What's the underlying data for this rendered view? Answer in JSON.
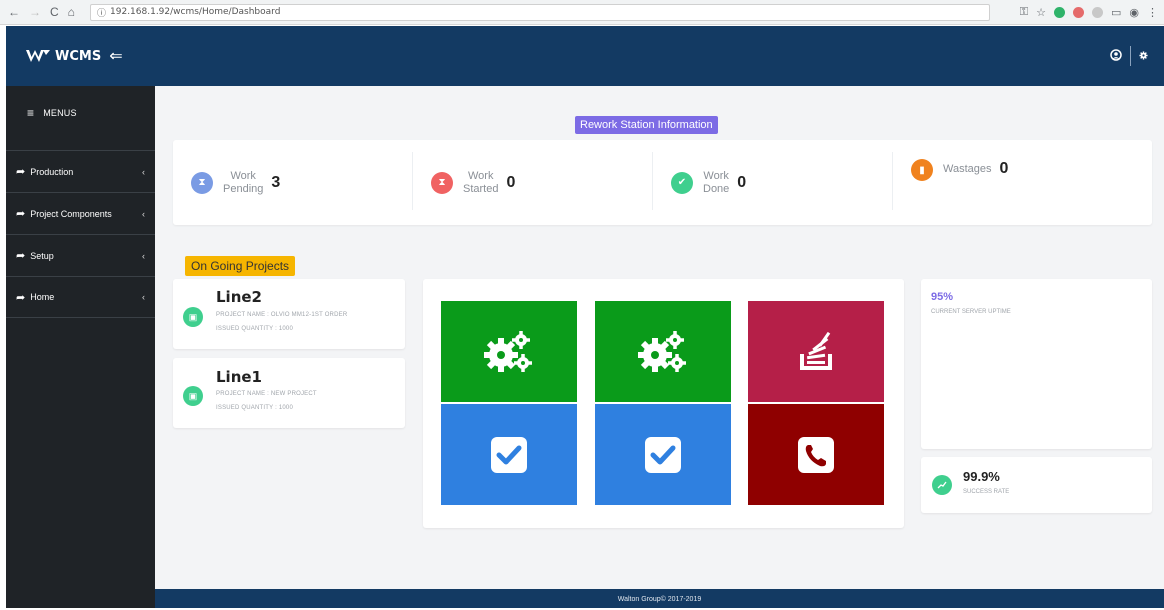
{
  "browser": {
    "url": "192.168.1.92/wcms/Home/Dashboard"
  },
  "header": {
    "app_name": "WCMS"
  },
  "sidebar": {
    "menus_label": "MENUS",
    "items": [
      {
        "label": "Production"
      },
      {
        "label": "Project Components"
      },
      {
        "label": "Setup"
      },
      {
        "label": "Home"
      }
    ]
  },
  "main": {
    "section_title": "Rework Station Information",
    "stats": [
      {
        "line1": "Work",
        "line2": "Pending",
        "value": "3",
        "color": "#7a9be4",
        "icon": "hourglass-icon"
      },
      {
        "line1": "Work",
        "line2": "Started",
        "value": "0",
        "color": "#f06262",
        "icon": "hourglass-icon"
      },
      {
        "line1": "Work",
        "line2": "Done",
        "value": "0",
        "color": "#3fcf8e",
        "icon": "check-icon"
      },
      {
        "line1": "Wastages",
        "line2": "",
        "value": "0",
        "color": "#f0821e",
        "icon": "trash-icon"
      }
    ],
    "ongoing_title": "On Going Projects",
    "projects": [
      {
        "name": "Line2",
        "project_name": "PROJECT NAME : OLVIO MM12-1ST ORDER",
        "quantity": "ISSUED QUANTITY : 1000"
      },
      {
        "name": "Line1",
        "project_name": "PROJECT NAME : NEW PROJECT",
        "quantity": "ISSUED QUANTITY : 1000"
      }
    ],
    "tiles": [
      {
        "icon": "gears-icon",
        "color": "#0a9b1a"
      },
      {
        "icon": "gears-icon",
        "color": "#0a9b1a"
      },
      {
        "icon": "stack-icon",
        "color": "#b51f48"
      },
      {
        "icon": "checkbox-icon",
        "color": "#2f80e0"
      },
      {
        "icon": "checkbox-icon",
        "color": "#2f80e0"
      },
      {
        "icon": "phone-icon",
        "color": "#8f0000"
      }
    ],
    "uptime": {
      "value": "95%",
      "label": "CURRENT SERVER UPTIME"
    },
    "success": {
      "value": "99.9%",
      "label": "SUCCESS RATE"
    }
  },
  "footer": {
    "text": "Walton Group© 2017-2019"
  }
}
